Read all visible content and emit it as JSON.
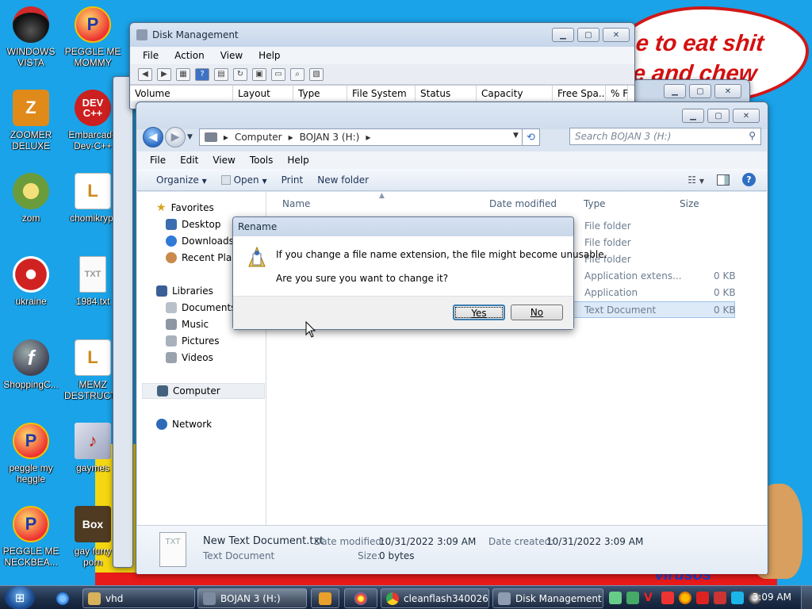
{
  "desktop": {
    "wallpaper_text": "e to eat shit\ne and chew",
    "wallpaper_bottom_text": "virusos",
    "icons": [
      {
        "label": "WINDOWS\nVISTA",
        "glyph": "",
        "icon": "vista-icon"
      },
      {
        "label": "PEGGLE ME\nMOMMY",
        "glyph": "P",
        "icon": "peggle-icon"
      },
      {
        "label": "ZOOMER\nDELUXE",
        "glyph": "Z",
        "icon": "zoomer-icon"
      },
      {
        "label": "Embarcade\nDev-C++",
        "glyph": "DEV C++",
        "icon": "devcpp-icon"
      },
      {
        "label": "zom",
        "glyph": "",
        "icon": "flower-icon"
      },
      {
        "label": "chomikrypt",
        "glyph": "L",
        "icon": "shortcut-icon"
      },
      {
        "label": "ukraine",
        "glyph": "",
        "icon": "radiation-icon"
      },
      {
        "label": "1984.txt",
        "glyph": "TXT",
        "icon": "text-file-icon"
      },
      {
        "label": "ShoppingC...",
        "glyph": "f",
        "icon": "flash-icon"
      },
      {
        "label": "MEMZ\nDESTRUCTI...",
        "glyph": "L",
        "icon": "shortcut-icon"
      },
      {
        "label": "peggle my\nheggle",
        "glyph": "P",
        "icon": "peggle-icon"
      },
      {
        "label": "gaymes",
        "glyph": "♪",
        "icon": "folder-icon"
      },
      {
        "label": "PEGGLE ME\nNECKBEA...",
        "glyph": "P",
        "icon": "peggle-icon"
      },
      {
        "label": "gay furry\nporn",
        "glyph": "Box",
        "icon": "box-icon"
      }
    ]
  },
  "disk_management": {
    "title": "Disk Management",
    "menu": [
      "File",
      "Action",
      "View",
      "Help"
    ],
    "columns": [
      "Volume",
      "Layout",
      "Type",
      "File System",
      "Status",
      "Capacity",
      "Free Spa...",
      "% F"
    ]
  },
  "explorer": {
    "breadcrumb": [
      "Computer",
      "BOJAN 3 (H:)"
    ],
    "search_placeholder": "Search BOJAN 3 (H:)",
    "menu": [
      "File",
      "Edit",
      "View",
      "Tools",
      "Help"
    ],
    "commands": [
      "Organize",
      "Open",
      "Print",
      "New folder"
    ],
    "nav": {
      "favorites": "Favorites",
      "favorites_items": [
        "Desktop",
        "Downloads",
        "Recent Places"
      ],
      "libraries": "Libraries",
      "libraries_items": [
        "Documents",
        "Music",
        "Pictures",
        "Videos"
      ],
      "computer": "Computer",
      "network": "Network"
    },
    "columns": [
      "Name",
      "Date modified",
      "Type",
      "Size"
    ],
    "rows": [
      {
        "type": "File folder",
        "size": ""
      },
      {
        "type": "File folder",
        "size": ""
      },
      {
        "type": "File folder",
        "size": ""
      },
      {
        "type": "Application extens...",
        "size": "0 KB"
      },
      {
        "type": "Application",
        "size": "0 KB"
      },
      {
        "type": "Text Document",
        "size": "0 KB"
      }
    ],
    "details": {
      "filename": "New Text Document.txt",
      "filetype": "Text Document",
      "modified_label": "Date modified:",
      "modified_value": "10/31/2022 3:09 AM",
      "created_label": "Date created:",
      "created_value": "10/31/2022 3:09 AM",
      "size_label": "Size:",
      "size_value": "0 bytes"
    }
  },
  "rename_dialog": {
    "title": "Rename",
    "message": "If you change a file name extension, the file might become unusable.",
    "question": "Are you sure you want to change it?",
    "yes_label": "Yes",
    "no_label": "No"
  },
  "taskbar": {
    "items": [
      {
        "label": "vhd",
        "icon": "folder-icon"
      },
      {
        "label": "BOJAN 3 (H:)",
        "icon": "drive-icon"
      },
      {
        "label": "",
        "icon": "media-player-icon"
      },
      {
        "label": "",
        "icon": "paint-icon"
      },
      {
        "label": "cleanflash340026...",
        "icon": "chrome-icon"
      },
      {
        "label": "Disk Management",
        "icon": "disk-management-icon"
      }
    ],
    "clock": "3:09 AM"
  }
}
